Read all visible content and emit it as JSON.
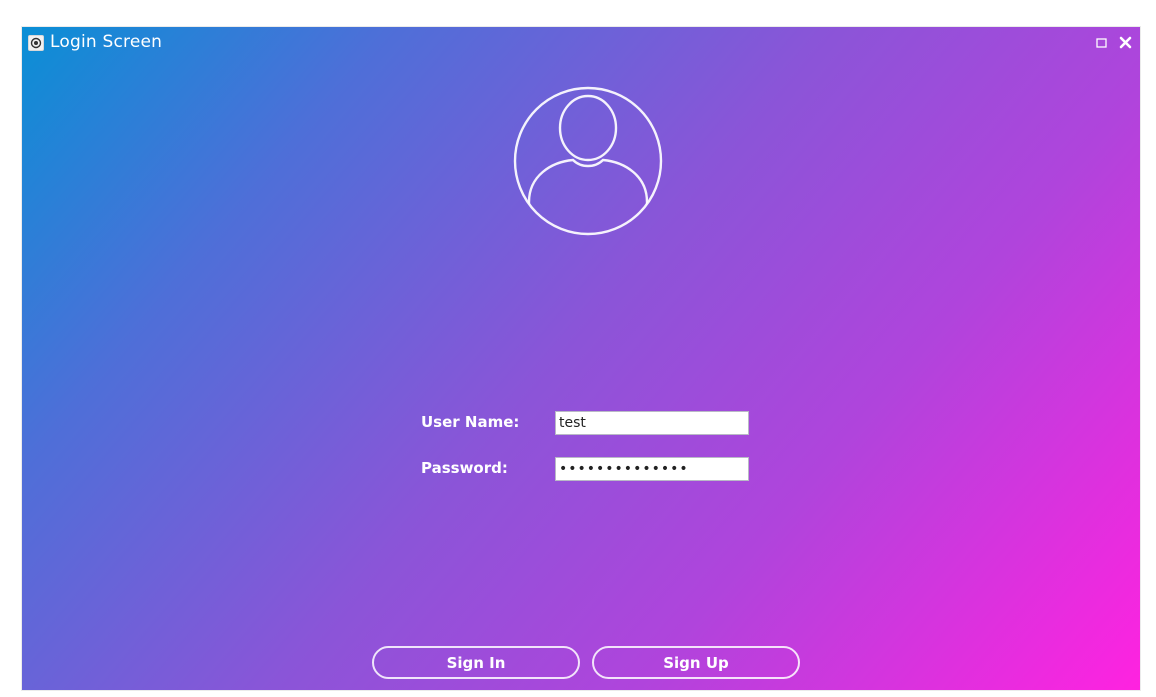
{
  "window": {
    "title": "Login Screen",
    "icons": {
      "app": "app-window-icon",
      "maximize": "maximize-icon",
      "close": "close-icon"
    }
  },
  "avatar": {
    "icon": "user-avatar-icon"
  },
  "form": {
    "username": {
      "label": "User Name:",
      "value": "test"
    },
    "password": {
      "label": "Password:",
      "value": "••••••••••••••"
    }
  },
  "buttons": {
    "sign_in": "Sign In",
    "sign_up": "Sign Up"
  },
  "colors": {
    "gradient_start": "#0a8fd6",
    "gradient_end": "#ff22e0",
    "text": "#ffffff"
  }
}
